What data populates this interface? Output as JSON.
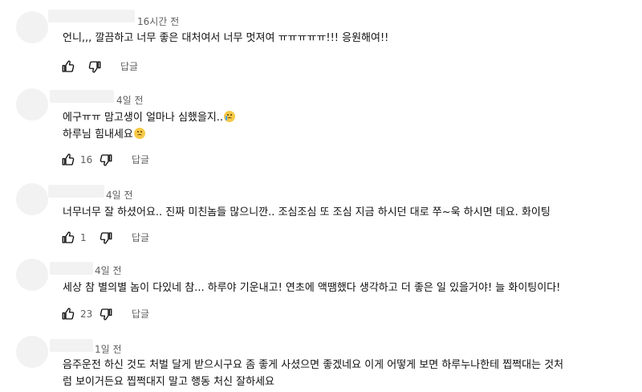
{
  "comments": [
    {
      "timestamp": "16시간 전",
      "lines": [
        "언니,,, 깔끔하고 너무 좋은 대처여서 너무 멋져여 ㅠㅠㅠㅠㅠ!!! 응원해여!!"
      ],
      "likes": "",
      "reply_label": "답글"
    },
    {
      "timestamp": "4일 전",
      "lines": [
        "에구ㅠㅠ 맘고생이 얼마나 심했을지..",
        "하루님  힘내세요"
      ],
      "emojis": [
        "loudly-crying-face",
        "sad-face"
      ],
      "likes": "16",
      "reply_label": "답글"
    },
    {
      "timestamp": "4일 전",
      "lines": [
        "너무너무 잘 하셨어요.. 진짜 미친놈들 많으니깐.. 조심조심 또 조심 지금 하시던 대로 쭈~욱 하시면 데요. 화이팅"
      ],
      "likes": "1",
      "reply_label": "답글"
    },
    {
      "timestamp": "4일 전",
      "lines": [
        "세상 참 별의별 놈이 다있네 참... 하루야 기운내고! 연초에 액땜했다 생각하고 더 좋은 일 있을거야! 늘 화이팅이다!"
      ],
      "likes": "23",
      "reply_label": "답글"
    },
    {
      "timestamp": "1일 전",
      "lines": [
        "음주운전 하신 것도 처벌 달게 받으시구요 좀 좋게 사셨으면 좋겠네요 이게 어떻게 보면 하루누나한테 찝쩍대는 것처",
        "럼 보이거든요 찝쩍대지 말고 행동 처신 잘하세요"
      ]
    }
  ]
}
